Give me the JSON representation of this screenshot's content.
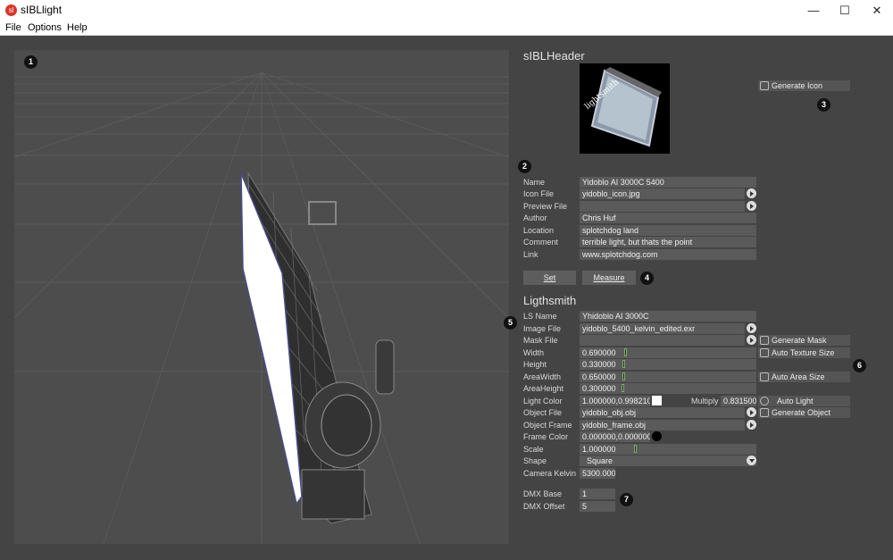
{
  "window": {
    "title": "sIBLlight",
    "app_icon_text": "sl",
    "minimize": "—",
    "maximize": "☐",
    "close": "✕"
  },
  "menu": [
    "File",
    "Options",
    "Help"
  ],
  "badges": [
    "1",
    "2",
    "3",
    "4",
    "5",
    "6",
    "7"
  ],
  "header": {
    "title": "sIBLHeader",
    "icon_caption": "lightsmith",
    "generate_icon_label": "Generate Icon",
    "fields": [
      {
        "label": "Name",
        "value": "Yidoblo AI 3000C 5400"
      },
      {
        "label": "Icon File",
        "value": "yidoblo_icon.jpg"
      },
      {
        "label": "Preview File",
        "value": ""
      },
      {
        "label": "Author",
        "value": "Chris Huf"
      },
      {
        "label": "Location",
        "value": "splotchdog land"
      },
      {
        "label": "Comment",
        "value": "terrible light, but thats the point"
      },
      {
        "label": "Link",
        "value": "www.splotchdog.com"
      }
    ],
    "set_label": "Set",
    "measure_label": "Measure"
  },
  "lightsmith": {
    "title": "Ligthsmith",
    "fields": [
      {
        "label": "LS Name",
        "value": "Yhidoblo AI 3000C"
      },
      {
        "label": "Image File",
        "value": "yidoblo_5400_kelvin_edited.exr"
      },
      {
        "label": "Mask File",
        "value": ""
      },
      {
        "label": "Width",
        "value": "0.690000"
      },
      {
        "label": "Height",
        "value": "0.330000"
      },
      {
        "label": "AreaWidth",
        "value": "0.650000"
      },
      {
        "label": "AreaHeight",
        "value": "0.300000"
      },
      {
        "label": "Light Color",
        "value": "1.000000,0.998210,"
      },
      {
        "label": "Object File",
        "value": "yidoblo_obj.obj"
      },
      {
        "label": "Object Frame",
        "value": "yidoblo_frame.obj"
      },
      {
        "label": "Frame Color",
        "value": "0.000000,0.000000,"
      },
      {
        "label": "Scale",
        "value": "1.000000"
      },
      {
        "label": "Shape",
        "value": "Square"
      },
      {
        "label": "Camera Kelvin",
        "value": "5300.0000"
      }
    ],
    "multiply_label": "Multiply",
    "multiply_value": "0.831500",
    "generate_mask_label": "Generate Mask",
    "auto_texture_size_label": "Auto Texture Size",
    "auto_area_size_label": "Auto Area Size",
    "auto_light_label": "Auto Light",
    "generate_object_label": "Generate Object",
    "dmx_base_label": "DMX Base",
    "dmx_base_value": "1",
    "dmx_offset_label": "DMX Offset",
    "dmx_offset_value": "5",
    "light_color_swatch": "#ffffff",
    "frame_color_swatch": "#000000"
  },
  "icons": [
    "generate-icon-icon",
    "generate-mask-icon",
    "auto-texture-size-icon",
    "auto-area-size-icon",
    "auto-light-icon",
    "generate-object-icon"
  ]
}
